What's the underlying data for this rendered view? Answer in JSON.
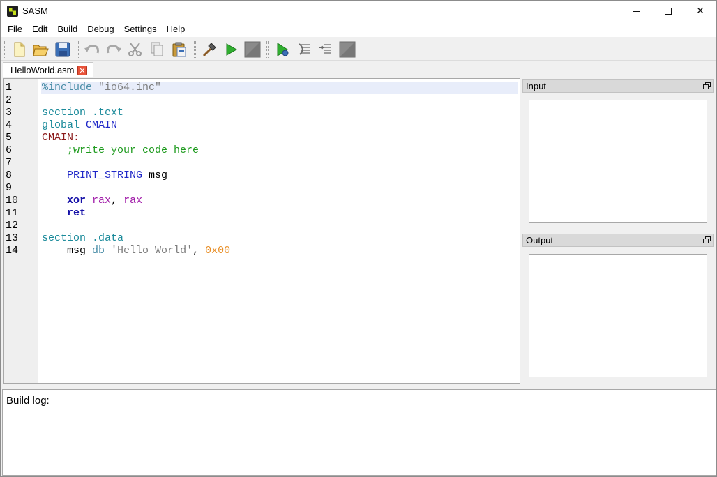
{
  "window": {
    "title": "SASM"
  },
  "menu": {
    "items": [
      "File",
      "Edit",
      "Build",
      "Debug",
      "Settings",
      "Help"
    ]
  },
  "toolbar": {
    "buttons": [
      {
        "name": "new-file-icon"
      },
      {
        "name": "open-folder-icon"
      },
      {
        "name": "save-icon"
      },
      {
        "name": "undo-icon"
      },
      {
        "name": "redo-icon"
      },
      {
        "name": "cut-icon"
      },
      {
        "name": "copy-icon"
      },
      {
        "name": "paste-icon"
      },
      {
        "name": "build-hammer-icon"
      },
      {
        "name": "run-icon"
      },
      {
        "name": "stop-icon"
      },
      {
        "name": "debug-icon"
      },
      {
        "name": "step-over-icon"
      },
      {
        "name": "step-into-icon"
      },
      {
        "name": "stop-debug-icon"
      }
    ]
  },
  "tabs": [
    {
      "label": "HelloWorld.asm"
    }
  ],
  "editor": {
    "current_line": 1,
    "lines": [
      {
        "num": "1",
        "tokens": [
          {
            "t": "%include",
            "c": "pre"
          },
          {
            "t": " ",
            "c": "plain"
          },
          {
            "t": "\"io64.inc\"",
            "c": "str"
          }
        ]
      },
      {
        "num": "2",
        "tokens": []
      },
      {
        "num": "3",
        "tokens": [
          {
            "t": "section .text",
            "c": "kw"
          }
        ]
      },
      {
        "num": "4",
        "tokens": [
          {
            "t": "global",
            "c": "global"
          },
          {
            "t": " ",
            "c": "plain"
          },
          {
            "t": "CMAIN",
            "c": "name"
          }
        ]
      },
      {
        "num": "5",
        "tokens": [
          {
            "t": "CMAIN:",
            "c": "label"
          }
        ]
      },
      {
        "num": "6",
        "tokens": [
          {
            "t": "    ",
            "c": "plain"
          },
          {
            "t": ";write your code here",
            "c": "comment"
          }
        ]
      },
      {
        "num": "7",
        "tokens": []
      },
      {
        "num": "8",
        "tokens": [
          {
            "t": "    ",
            "c": "plain"
          },
          {
            "t": "PRINT_STRING",
            "c": "macro"
          },
          {
            "t": " msg",
            "c": "plain"
          }
        ]
      },
      {
        "num": "9",
        "tokens": []
      },
      {
        "num": "10",
        "tokens": [
          {
            "t": "    ",
            "c": "plain"
          },
          {
            "t": "xor",
            "c": "instr"
          },
          {
            "t": " ",
            "c": "plain"
          },
          {
            "t": "rax",
            "c": "reg"
          },
          {
            "t": ", ",
            "c": "plain"
          },
          {
            "t": "rax",
            "c": "reg"
          }
        ]
      },
      {
        "num": "11",
        "tokens": [
          {
            "t": "    ",
            "c": "plain"
          },
          {
            "t": "ret",
            "c": "instr"
          }
        ]
      },
      {
        "num": "12",
        "tokens": []
      },
      {
        "num": "13",
        "tokens": [
          {
            "t": "section .data",
            "c": "kw"
          }
        ]
      },
      {
        "num": "14",
        "tokens": [
          {
            "t": "    msg ",
            "c": "plain"
          },
          {
            "t": "db",
            "c": "db"
          },
          {
            "t": " ",
            "c": "plain"
          },
          {
            "t": "'Hello World'",
            "c": "str"
          },
          {
            "t": ", ",
            "c": "plain"
          },
          {
            "t": "0x00",
            "c": "num"
          }
        ]
      }
    ]
  },
  "panels": {
    "input": {
      "title": "Input",
      "value": ""
    },
    "output": {
      "title": "Output",
      "value": ""
    }
  },
  "build_log": {
    "label": "Build log:"
  }
}
